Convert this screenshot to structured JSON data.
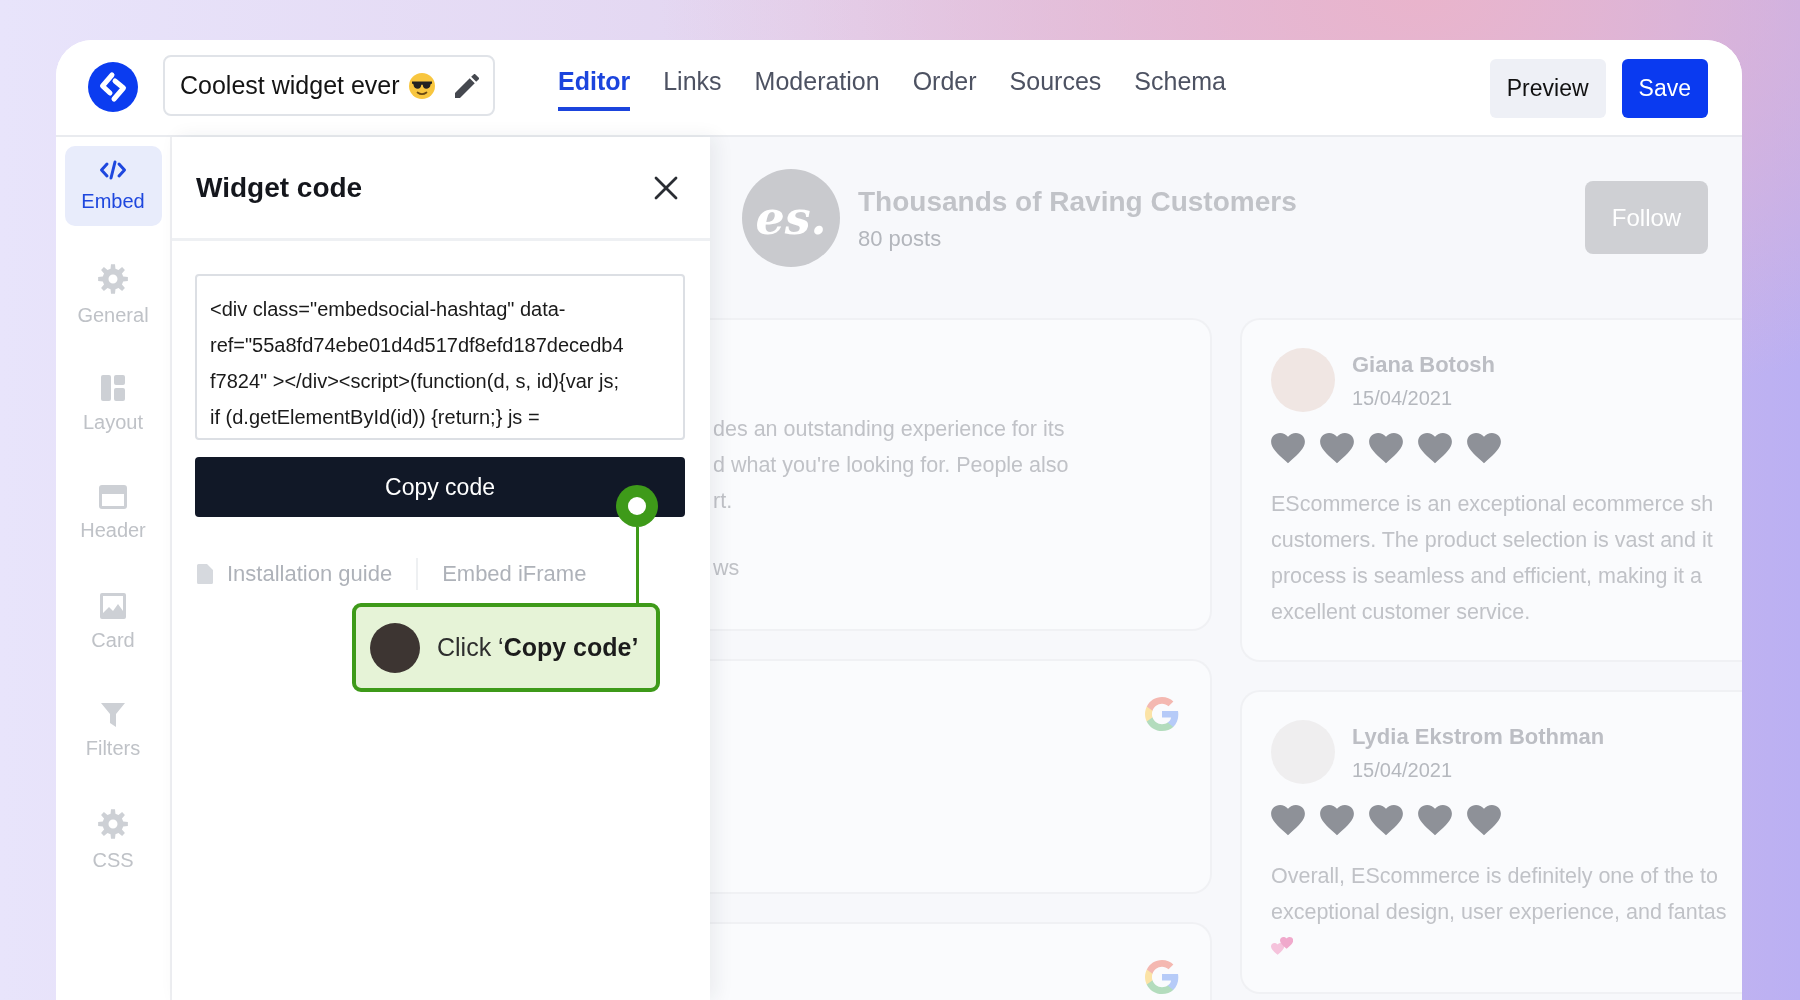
{
  "app": {
    "title": "Coolest widget ever",
    "tabs": [
      {
        "label": "Editor",
        "selected": true
      },
      {
        "label": "Links",
        "selected": false
      },
      {
        "label": "Moderation",
        "selected": false
      },
      {
        "label": "Order",
        "selected": false
      },
      {
        "label": "Sources",
        "selected": false
      },
      {
        "label": "Schema",
        "selected": false
      }
    ],
    "buttons": [
      {
        "label": "Preview",
        "kind": "secondary"
      },
      {
        "label": "Save",
        "kind": "primary"
      }
    ]
  },
  "sidebar": {
    "items": [
      {
        "label": "Embed",
        "kind": "code",
        "selected": true
      },
      {
        "label": "General",
        "kind": "gear",
        "selected": false
      },
      {
        "label": "Layout",
        "kind": "layout",
        "selected": false
      },
      {
        "label": "Header",
        "kind": "window",
        "selected": false
      },
      {
        "label": "Card",
        "kind": "image",
        "selected": false
      },
      {
        "label": "Filters",
        "kind": "funnel",
        "selected": false
      },
      {
        "label": "CSS",
        "kind": "gear",
        "selected": false
      }
    ]
  },
  "panel": {
    "title": "Widget code",
    "code_lines": [
      "<div class=\"embedsocial-hashtag\" data-",
      "ref=\"55a8fd74ebe01d4d517df8efd187decedb4",
      "f7824\" ></div><script>(function(d, s, id){var js;",
      "if (d.getElementById(id)) {return;} js ="
    ],
    "copy_button": "Copy code",
    "links": [
      "Installation guide",
      "Embed iFrame"
    ],
    "callout": "Click ‘**Copy code’**"
  },
  "preview": {
    "logo_text": "es.",
    "title": "Thousands of Raving Customers",
    "posts": "80 posts",
    "follow_button": "Follow",
    "feed_cards": [
      {
        "kind": "text",
        "lines": [
          "des an outstanding experience for its",
          "d what you're looking for. People also",
          "rt."
        ],
        "footer": "ws"
      },
      {
        "kind": "source"
      },
      {
        "kind": "source"
      }
    ],
    "reviews": [
      {
        "name": "Giana Botosh",
        "date": "15/04/2021",
        "stars": 5,
        "lines": [
          "EScommerce is an exceptional ecommerce sh",
          "customers. The product selection is vast and it",
          "process is seamless and efficient, making it a",
          "excellent customer service."
        ],
        "emoji": false
      },
      {
        "name": "Lydia Ekstrom Bothman",
        "date": "15/04/2021",
        "stars": 5,
        "lines": [
          "Overall, EScommerce is definitely one of the to",
          "exceptional design, user experience, and fantas"
        ],
        "emoji": true
      }
    ]
  }
}
